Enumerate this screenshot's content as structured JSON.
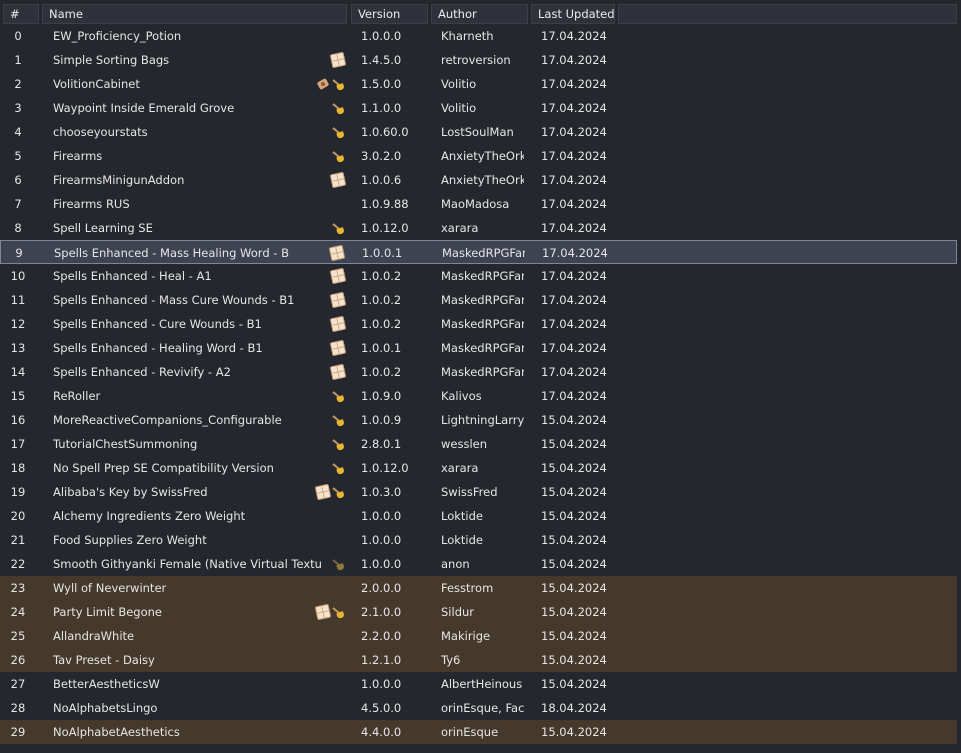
{
  "columns": {
    "idx": "#",
    "name": "Name",
    "version": "Version",
    "author": "Author",
    "updated": "Last Updated",
    "extra": ""
  },
  "mods": [
    {
      "idx": "0",
      "name": "EW_Proficiency_Potion",
      "version": "1.0.0.0",
      "author": "Kharneth",
      "updated": "17.04.2024",
      "icons": [],
      "state": "normal"
    },
    {
      "idx": "1",
      "name": "Simple Sorting Bags",
      "version": "1.4.5.0",
      "author": "retroversion",
      "updated": "17.04.2024",
      "icons": [
        "waffle-icon"
      ],
      "state": "normal"
    },
    {
      "idx": "2",
      "name": "VolitionCabinet",
      "version": "1.5.0.0",
      "author": "Volitio",
      "updated": "17.04.2024",
      "icons": [
        "plug-icon",
        "broom-icon"
      ],
      "state": "normal"
    },
    {
      "idx": "3",
      "name": "Waypoint Inside Emerald Grove",
      "version": "1.1.0.0",
      "author": "Volitio",
      "updated": "17.04.2024",
      "icons": [
        "broom-icon"
      ],
      "state": "normal"
    },
    {
      "idx": "4",
      "name": "chooseyourstats",
      "version": "1.0.60.0",
      "author": "LostSoulMan",
      "updated": "17.04.2024",
      "icons": [
        "broom-icon"
      ],
      "state": "normal"
    },
    {
      "idx": "5",
      "name": "Firearms",
      "version": "3.0.2.0",
      "author": "AnxietyTheOrk",
      "updated": "17.04.2024",
      "icons": [
        "broom-icon"
      ],
      "state": "normal"
    },
    {
      "idx": "6",
      "name": "FirearmsMinigunAddon",
      "version": "1.0.0.6",
      "author": "AnxietyTheOrk",
      "updated": "17.04.2024",
      "icons": [
        "waffle-icon"
      ],
      "state": "normal"
    },
    {
      "idx": "7",
      "name": "Firearms RUS",
      "version": "1.0.9.88",
      "author": "MaoMadosa",
      "updated": "17.04.2024",
      "icons": [],
      "state": "normal"
    },
    {
      "idx": "8",
      "name": "Spell Learning SE",
      "version": "1.0.12.0",
      "author": "xarara",
      "updated": "17.04.2024",
      "icons": [
        "broom-icon"
      ],
      "state": "normal"
    },
    {
      "idx": "9",
      "name": "Spells Enhanced - Mass Healing Word - B",
      "version": "1.0.0.1",
      "author": "MaskedRPGFan",
      "updated": "17.04.2024",
      "icons": [
        "waffle-icon"
      ],
      "state": "selected"
    },
    {
      "idx": "10",
      "name": "Spells Enhanced - Heal - A1",
      "version": "1.0.0.2",
      "author": "MaskedRPGFan",
      "updated": "17.04.2024",
      "icons": [
        "waffle-icon"
      ],
      "state": "normal"
    },
    {
      "idx": "11",
      "name": "Spells Enhanced - Mass Cure Wounds - B1",
      "version": "1.0.0.2",
      "author": "MaskedRPGFan",
      "updated": "17.04.2024",
      "icons": [
        "waffle-icon"
      ],
      "state": "normal"
    },
    {
      "idx": "12",
      "name": "Spells Enhanced - Cure Wounds - B1",
      "version": "1.0.0.2",
      "author": "MaskedRPGFan",
      "updated": "17.04.2024",
      "icons": [
        "waffle-icon"
      ],
      "state": "normal"
    },
    {
      "idx": "13",
      "name": "Spells Enhanced - Healing Word - B1",
      "version": "1.0.0.1",
      "author": "MaskedRPGFan",
      "updated": "17.04.2024",
      "icons": [
        "waffle-icon"
      ],
      "state": "normal"
    },
    {
      "idx": "14",
      "name": "Spells Enhanced - Revivify - A2",
      "version": "1.0.0.2",
      "author": "MaskedRPGFan",
      "updated": "17.04.2024",
      "icons": [
        "waffle-icon"
      ],
      "state": "normal"
    },
    {
      "idx": "15",
      "name": "ReRoller",
      "version": "1.0.9.0",
      "author": "Kalivos",
      "updated": "17.04.2024",
      "icons": [
        "broom-icon"
      ],
      "state": "normal"
    },
    {
      "idx": "16",
      "name": "MoreReactiveCompanions_Configurable",
      "version": "1.0.0.9",
      "author": "LightningLarryL",
      "updated": "15.04.2024",
      "icons": [
        "broom-icon"
      ],
      "state": "normal"
    },
    {
      "idx": "17",
      "name": "TutorialChestSummoning",
      "version": "2.8.0.1",
      "author": "wesslen",
      "updated": "15.04.2024",
      "icons": [
        "broom-icon"
      ],
      "state": "normal"
    },
    {
      "idx": "18",
      "name": "No Spell Prep SE Compatibility Version",
      "version": "1.0.12.0",
      "author": "xarara",
      "updated": "15.04.2024",
      "icons": [
        "broom-icon"
      ],
      "state": "normal"
    },
    {
      "idx": "19",
      "name": "Alibaba's Key by SwissFred",
      "version": "1.0.3.0",
      "author": "SwissFred",
      "updated": "15.04.2024",
      "icons": [
        "waffle-icon",
        "broom-icon"
      ],
      "state": "normal"
    },
    {
      "idx": "20",
      "name": "Alchemy Ingredients Zero Weight",
      "version": "1.0.0.0",
      "author": "Loktide",
      "updated": "15.04.2024",
      "icons": [],
      "state": "normal"
    },
    {
      "idx": "21",
      "name": "Food Supplies Zero Weight",
      "version": "1.0.0.0",
      "author": "Loktide",
      "updated": "15.04.2024",
      "icons": [],
      "state": "normal"
    },
    {
      "idx": "22",
      "name": "Smooth Githyanki Female (Native Virtual Texture)",
      "version": "1.0.0.0",
      "author": "anon",
      "updated": "15.04.2024",
      "icons": [
        "broom-dim-icon"
      ],
      "state": "normal"
    },
    {
      "idx": "23",
      "name": "Wyll of Neverwinter",
      "version": "2.0.0.0",
      "author": "Fesstrom",
      "updated": "15.04.2024",
      "icons": [],
      "state": "highlight"
    },
    {
      "idx": "24",
      "name": "Party Limit Begone",
      "version": "2.1.0.0",
      "author": "Sildur",
      "updated": "15.04.2024",
      "icons": [
        "waffle-icon",
        "broom-icon"
      ],
      "state": "highlight"
    },
    {
      "idx": "25",
      "name": "AllandraWhite",
      "version": "2.2.0.0",
      "author": "Makirige",
      "updated": "15.04.2024",
      "icons": [],
      "state": "highlight"
    },
    {
      "idx": "26",
      "name": "Tav Preset - Daisy",
      "version": "1.2.1.0",
      "author": "Ty6",
      "updated": "15.04.2024",
      "icons": [],
      "state": "highlight"
    },
    {
      "idx": "27",
      "name": "BetterAestheticsW",
      "version": "1.0.0.0",
      "author": "AlbertHeinous",
      "updated": "15.04.2024",
      "icons": [],
      "state": "normal"
    },
    {
      "idx": "28",
      "name": "NoAlphabetsLingo",
      "version": "4.5.0.0",
      "author": "orinEsque, Facele",
      "updated": "18.04.2024",
      "icons": [],
      "state": "normal"
    },
    {
      "idx": "29",
      "name": "NoAlphabetAesthetics",
      "version": "4.4.0.0",
      "author": "orinEsque",
      "updated": "15.04.2024",
      "icons": [],
      "state": "highlight"
    }
  ]
}
